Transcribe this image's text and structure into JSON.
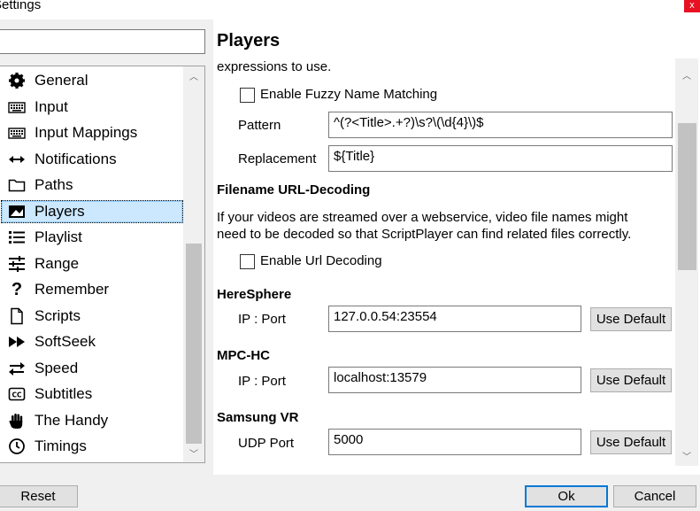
{
  "window": {
    "title": "Settings",
    "close_icon": "close-icon"
  },
  "search": {
    "value": "",
    "placeholder": ""
  },
  "categories": [
    {
      "label": "General",
      "icon": "gear-icon"
    },
    {
      "label": "Input",
      "icon": "keyboard-icon"
    },
    {
      "label": "Input Mappings",
      "icon": "keyboard-icon"
    },
    {
      "label": "Notifications",
      "icon": "double-arrow-icon"
    },
    {
      "label": "Paths",
      "icon": "folder-icon"
    },
    {
      "label": "Players",
      "icon": "image-player-icon",
      "selected": true
    },
    {
      "label": "Playlist",
      "icon": "list-icon"
    },
    {
      "label": "Range",
      "icon": "sliders-icon"
    },
    {
      "label": "Remember",
      "icon": "question-icon"
    },
    {
      "label": "Scripts",
      "icon": "file-icon"
    },
    {
      "label": "SoftSeek",
      "icon": "fast-forward-icon"
    },
    {
      "label": "Speed",
      "icon": "swap-icon"
    },
    {
      "label": "Subtitles",
      "icon": "closed-caption-icon"
    },
    {
      "label": "The Handy",
      "icon": "hand-icon"
    },
    {
      "label": "Timings",
      "icon": "clock-icon"
    }
  ],
  "main": {
    "title": "Players",
    "expressions_text": "expressions to use.",
    "fuzzy_checkbox_label": "Enable Fuzzy Name Matching",
    "fuzzy_checked": false,
    "pattern_label": "Pattern",
    "pattern_value": "^(?<Title>.+?)\\s?\\(\\d{4}\\)$",
    "replacement_label": "Replacement",
    "replacement_value": "${Title}",
    "url_decoding_heading": "Filename URL-Decoding",
    "url_decoding_desc_1": "If your videos are streamed over a webservice, video file names might",
    "url_decoding_desc_2": "need to be decoded so that ScriptPlayer can find related files correctly.",
    "url_decoding_checkbox_label": "Enable Url Decoding",
    "url_decoding_checked": false,
    "heresphere": {
      "heading": "HereSphere",
      "label": "IP : Port",
      "value": "127.0.0.54:23554",
      "button": "Use Default"
    },
    "mpchc": {
      "heading": "MPC-HC",
      "label": "IP : Port",
      "value": "localhost:13579",
      "button": "Use Default"
    },
    "samsung": {
      "heading": "Samsung VR",
      "label": "UDP Port",
      "value": "5000",
      "button": "Use Default"
    }
  },
  "footer": {
    "reset": "Reset",
    "ok": "Ok",
    "cancel": "Cancel"
  },
  "colors": {
    "selection_bg": "#cce8ff",
    "selection_border": "#99d1ff",
    "primary_border": "#0078d7",
    "close_bg": "#e81123"
  }
}
